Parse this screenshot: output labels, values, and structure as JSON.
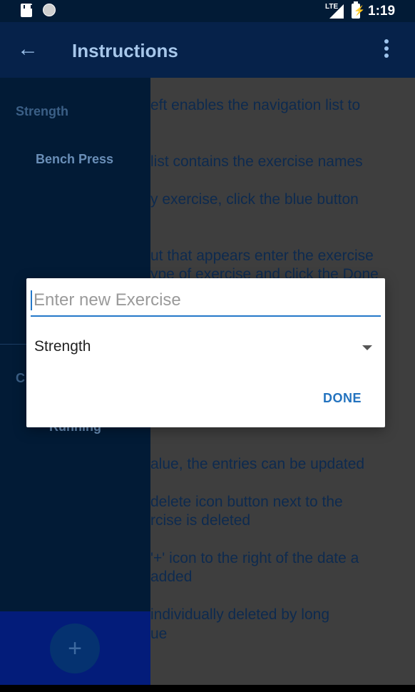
{
  "status_bar": {
    "network": "LTE",
    "time": "1:19"
  },
  "app_bar": {
    "title": "Instructions",
    "back_icon": "arrow-left-icon",
    "menu_icon": "more-vertical-icon"
  },
  "background_text": [
    "eft enables the navigation list to",
    "list contains the exercise names",
    "y exercise, click the blue button",
    "ut that appears enter the exercise",
    "ype of exercise and click the Done",
    "alue, the entries can be updated",
    "delete icon button next to the",
    "rcise is deleted",
    "'+' icon to the right of the date a",
    "added",
    "individually deleted by long",
    "ue"
  ],
  "drawer": {
    "sections": [
      {
        "header": "Strength",
        "items": [
          "Bench Press"
        ]
      },
      {
        "header": "C",
        "items": [
          "Running"
        ]
      }
    ],
    "fab_label": "+",
    "fab_icon": "plus-icon"
  },
  "dialog": {
    "input_placeholder": "Enter new Exercise",
    "input_value": "",
    "select_value": "Strength",
    "done_label": "DONE"
  },
  "colors": {
    "accent": "#2478c9",
    "appbar": "#06224a",
    "drawer": "#021b36"
  }
}
